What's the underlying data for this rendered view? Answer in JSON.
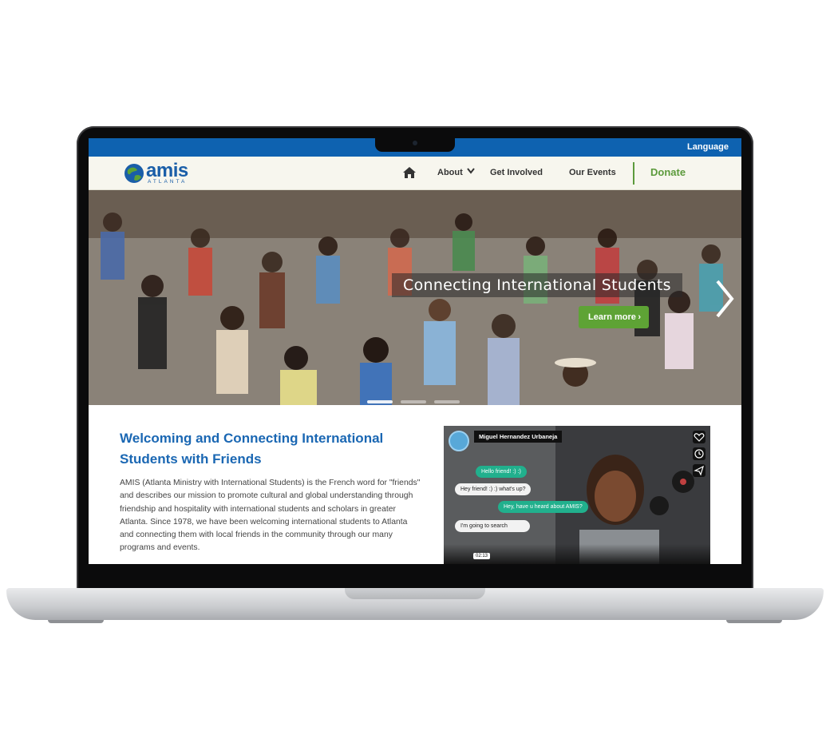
{
  "topbar": {
    "language_label": "Language"
  },
  "logo": {
    "wordmark": "amis",
    "subtitle": "ATLANTA"
  },
  "nav": {
    "about": "About",
    "get_involved": "Get Involved",
    "our_events": "Our Events",
    "donate": "Donate"
  },
  "hero": {
    "caption": "Connecting International Students",
    "button": "Learn more",
    "slides_count": 3,
    "active_slide": 1
  },
  "main": {
    "title": "Welcoming and Connecting International Students with Friends",
    "body": "AMIS (Atlanta Ministry with International Students) is the French word for \"friends\" and describes our mission to promote cultural and global understanding through friendship and hospitality with international students and scholars in greater Atlanta. Since 1978, we have been welcoming international students to Atlanta and connecting them with local friends in the community through our many programs and events."
  },
  "video": {
    "name": "Miguel Hernandez Urbaneja",
    "messages": [
      "Hello friend! :) :)",
      "Hey friend! :) :) what's up?",
      "Hey, have u heard about AMIS?",
      "I'm going to search"
    ],
    "timestamp": "02:13"
  },
  "colors": {
    "topbar": "#0e62b0",
    "brand_blue": "#1a67b3",
    "donate_green": "#5c9a3c",
    "button_green": "#5ea335"
  },
  "icons": [
    "home-icon",
    "chevron-down-icon",
    "chevron-right-icon",
    "heart-icon",
    "clock-icon",
    "share-icon"
  ]
}
